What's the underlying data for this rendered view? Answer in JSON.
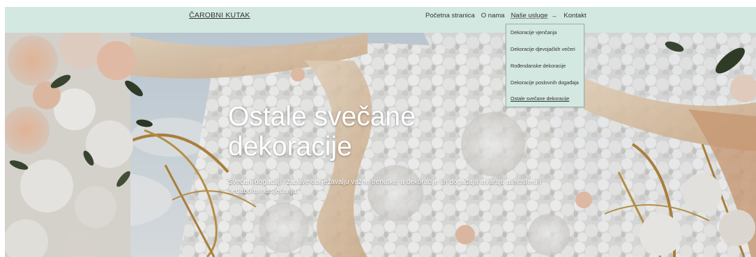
{
  "header": {
    "brand": "ČAROBNI KUTAK",
    "nav": {
      "home": "Početna stranica",
      "about": "O nama",
      "services": "Naše usluge",
      "services_caret": "–",
      "contact": "Kontakt"
    },
    "dropdown": [
      "Dekoracije vjenčanja",
      "Dekoracije djevojačkih večeri",
      "Rođendanske dekoracije",
      "Dekoracije poslovnih događaja",
      "Ostale svečane dekoracije"
    ]
  },
  "hero": {
    "title": "Ostale svečane dekoracije",
    "text": "Svečani događaji i zabave obilježavalju važne trenutke, a dekoracije tih događaja stvaraju atmosferu i nedaboravna sjećanja."
  },
  "colors": {
    "header_bg": "#d3e8e1",
    "text": "#333333",
    "hero_text": "#ffffff"
  }
}
